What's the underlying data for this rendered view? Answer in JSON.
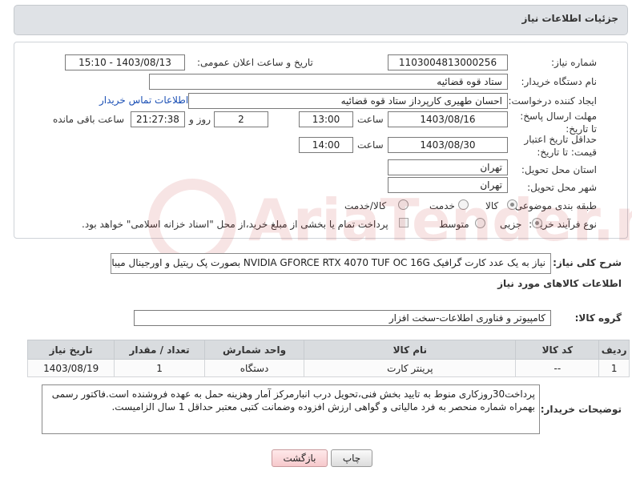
{
  "header": {
    "title": "جزئیات اطلاعات نیاز"
  },
  "form": {
    "need_number": {
      "label": "شماره نیاز:",
      "value": "1103004813000256"
    },
    "announce": {
      "label": "تاریخ و ساعت اعلان عمومی:",
      "value": "1403/08/13 - 15:10"
    },
    "buyer_org": {
      "label": "نام دستگاه خریدار:",
      "value": "ستاد قوه قضائیه"
    },
    "creator": {
      "label": "ایجاد کننده درخواست:",
      "value": "احسان طهیری کارپرداز ستاد قوه قضائیه",
      "contact_link": "اطلاعات تماس خریدار"
    },
    "deadline": {
      "label": "مهلت ارسال پاسخ: تا تاریخ:",
      "date": "1403/08/16",
      "time_label": "ساعت",
      "time": "13:00",
      "days": "2",
      "days_label": "روز و",
      "remaining": "21:27:38",
      "remaining_label": "ساعت باقی مانده"
    },
    "price_validity": {
      "label": "حداقل تاریخ اعتبار قیمت: تا تاریخ:",
      "date": "1403/08/30",
      "time_label": "ساعت",
      "time": "14:00"
    },
    "province": {
      "label": "استان محل تحویل:",
      "value": "تهران"
    },
    "city": {
      "label": "شهر محل تحویل:",
      "value": "تهران"
    },
    "category": {
      "label": "طبقه بندی موضوعی:",
      "options": [
        "کالا",
        "خدمت",
        "کالا/خدمت"
      ],
      "selected": "کالا"
    },
    "process": {
      "label": "نوع فرآیند خرید :",
      "options": [
        "جزیی",
        "متوسط"
      ],
      "selected": "جزیی",
      "payment_note": "پرداخت تمام یا بخشی از مبلغ خرید،از محل \"اسناد خزانه اسلامی\" خواهد بود."
    }
  },
  "description": {
    "label": "شرح کلی نیاز:",
    "value": "نیاز به یک عدد کارت گرافیک NVIDIA GFORCE RTX 4070 TUF OC 16G بصورت پک ریتیل و اورجینال میباشد."
  },
  "goods_info": {
    "title": "اطلاعات کالاهای مورد نیاز"
  },
  "goods_group": {
    "label": "گروه کالا:",
    "value": "کامپیوتر و فناوری اطلاعات-سخت افزار"
  },
  "table": {
    "headers": [
      "ردیف",
      "کد کالا",
      "نام کالا",
      "واحد شمارش",
      "تعداد / مقدار",
      "تاریخ نیاز"
    ],
    "rows": [
      [
        "1",
        "--",
        "پرینتر کارت",
        "دستگاه",
        "1",
        "1403/08/19"
      ]
    ]
  },
  "buyer_notes": {
    "label": "توضیحات خریدار:",
    "value": "پرداخت30روزکاری منوط به تایید بخش فنی،تحویل درب انبارمرکز آمار وهزینه حمل به عهده فروشنده است.فاکتور رسمی بهمراه شماره منحصر به فرد مالیاتی و گواهی ارزش افزوده وضمانت کتبی معتبر حداقل 1 سال الزامیست."
  },
  "buttons": {
    "print": "چاپ",
    "back": "بازگشت"
  },
  "watermark": {
    "text": "AriaTender.neT"
  },
  "colors": {
    "header_bg": "#dfe2e6",
    "link": "#1a4fb5",
    "back_button": "#f6c9cc"
  }
}
